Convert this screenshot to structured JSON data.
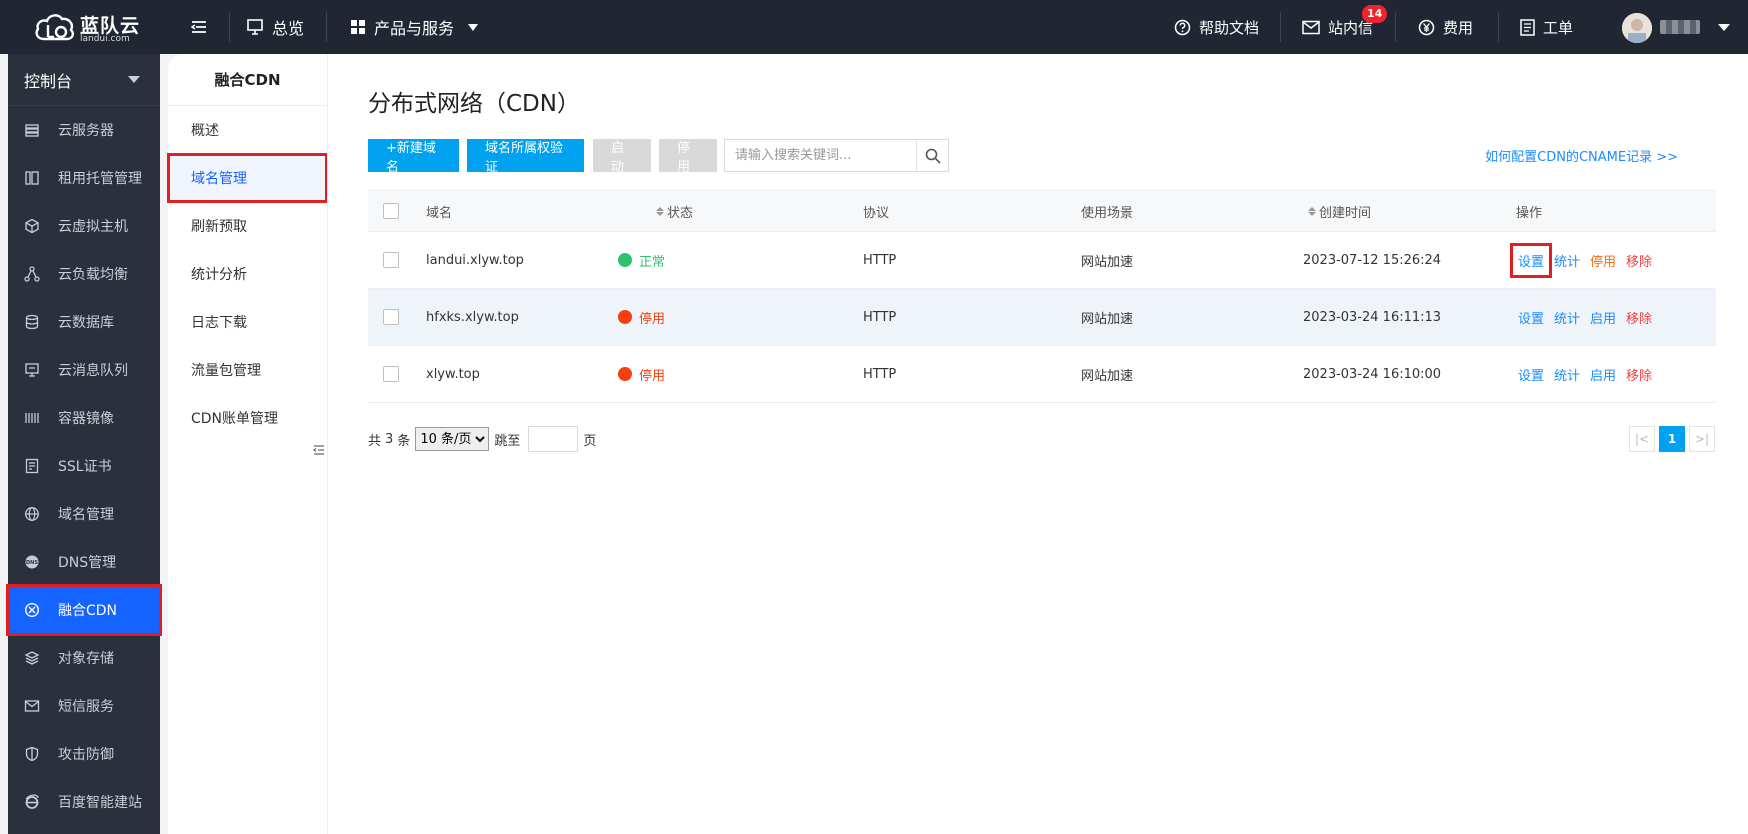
{
  "brand": {
    "name": "蓝队云",
    "domain": "landui.com"
  },
  "topnav": {
    "overview": "总览",
    "products": "产品与服务"
  },
  "topright": {
    "docs": "帮助文档",
    "messages": "站内信",
    "message_count": "14",
    "billing": "费用",
    "tickets": "工单"
  },
  "sidebar": {
    "console": "控制台",
    "items": [
      {
        "label": "云服务器",
        "icon": "server-icon"
      },
      {
        "label": "租用托管管理",
        "icon": "hosting-icon"
      },
      {
        "label": "云虚拟主机",
        "icon": "cube-icon"
      },
      {
        "label": "云负载均衡",
        "icon": "load-balance-icon"
      },
      {
        "label": "云数据库",
        "icon": "database-icon"
      },
      {
        "label": "云消息队列",
        "icon": "message-queue-icon"
      },
      {
        "label": "容器镜像",
        "icon": "container-icon"
      },
      {
        "label": "SSL证书",
        "icon": "certificate-icon"
      },
      {
        "label": "域名管理",
        "icon": "globe-icon"
      },
      {
        "label": "DNS管理",
        "icon": "dns-icon"
      },
      {
        "label": "融合CDN",
        "icon": "cdn-icon"
      },
      {
        "label": "对象存储",
        "icon": "layers-icon"
      },
      {
        "label": "短信服务",
        "icon": "mail-icon"
      },
      {
        "label": "攻击防御",
        "icon": "shield-icon"
      },
      {
        "label": "百度智能建站",
        "icon": "ie-icon"
      }
    ]
  },
  "submenu": {
    "title": "融合CDN",
    "items": [
      "概述",
      "域名管理",
      "刷新预取",
      "统计分析",
      "日志下载",
      "流量包管理",
      "CDN账单管理"
    ]
  },
  "main": {
    "title": "分布式网络（CDN）",
    "buttons": {
      "new_domain": "+新建域名",
      "verify": "域名所属权验证",
      "start": "启动",
      "stop": "停用"
    },
    "search_placeholder": "请输入搜索关键词...",
    "cname_link": "如何配置CDN的CNAME记录 >>",
    "columns": {
      "domain": "域名",
      "status": "状态",
      "protocol": "协议",
      "scenario": "使用场景",
      "created": "创建时间",
      "actions": "操作"
    },
    "rows": [
      {
        "domain": "landui.xlyw.top",
        "status": "正常",
        "status_color": "#2bc46c",
        "protocol": "HTTP",
        "scenario": "网站加速",
        "created": "2023-07-12 15:26:24",
        "actions": [
          "设置",
          "统计",
          "停用",
          "移除"
        ]
      },
      {
        "domain": "hfxks.xlyw.top",
        "status": "停用",
        "status_color": "#f53f0f",
        "protocol": "HTTP",
        "scenario": "网站加速",
        "created": "2023-03-24 16:11:13",
        "actions": [
          "设置",
          "统计",
          "启用",
          "移除"
        ]
      },
      {
        "domain": "xlyw.top",
        "status": "停用",
        "status_color": "#f53f0f",
        "protocol": "HTTP",
        "scenario": "网站加速",
        "created": "2023-03-24 16:10:00",
        "actions": [
          "设置",
          "统计",
          "启用",
          "移除"
        ]
      }
    ],
    "footer": {
      "total_prefix": "共",
      "total": "3",
      "total_suffix": "条",
      "page_size": "10 条/页",
      "jump": "跳至",
      "page_unit": "页",
      "current_page": "1"
    }
  },
  "colors": {
    "topbar": "#202732",
    "sidebar": "#2a313c",
    "primary": "#00a2f0",
    "active": "#1664ff",
    "highlight": "#e02020"
  }
}
